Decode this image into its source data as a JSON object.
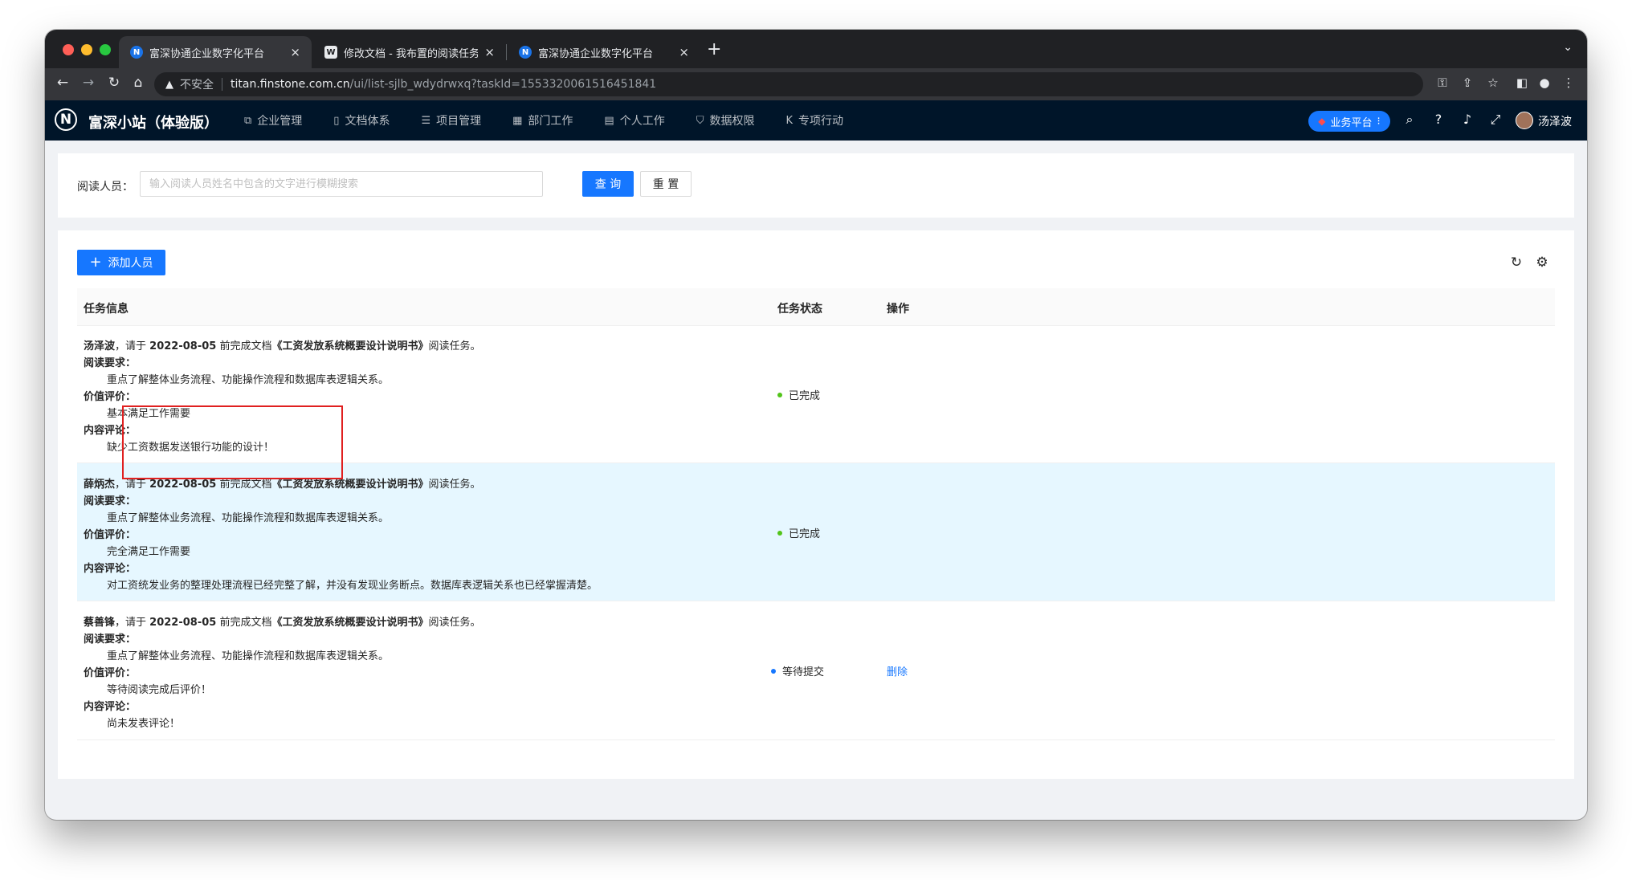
{
  "browser": {
    "tabs": [
      {
        "title": "富深协通企业数字化平台",
        "icon": "app-logo",
        "active": true
      },
      {
        "title": "修改文档 - 我布置的阅读任务 - 富",
        "icon": "doc-icon",
        "active": false
      },
      {
        "title": "富深协通企业数字化平台",
        "icon": "app-logo",
        "active": false
      }
    ],
    "close_glyph": "×",
    "new_tab_glyph": "+",
    "security_label": "不安全",
    "url_host": "titan.finstone.com.cn",
    "url_path": "/ui/list-sjlb_wdydrwxq?taskId=1553320061516451841"
  },
  "app": {
    "logo_letter": "N",
    "name": "富深小站（体验版）",
    "menu": [
      {
        "label": "企业管理",
        "icon": "enterprise-icon"
      },
      {
        "label": "文档体系",
        "icon": "document-icon"
      },
      {
        "label": "项目管理",
        "icon": "list-icon"
      },
      {
        "label": "部门工作",
        "icon": "grid-icon"
      },
      {
        "label": "个人工作",
        "icon": "profile-icon"
      },
      {
        "label": "数据权限",
        "icon": "shield-icon"
      },
      {
        "label": "专项行动",
        "icon": "k-icon"
      }
    ],
    "platform_button": "业务平台",
    "user_name": "汤泽波"
  },
  "search": {
    "label": "阅读人员：",
    "placeholder": "输入阅读人员姓名中包含的文字进行模糊搜索",
    "query_button": "查 询",
    "reset_button": "重 置"
  },
  "table": {
    "add_button": "添加人员",
    "columns": {
      "info": "任务信息",
      "status": "任务状态",
      "action": "操作"
    },
    "labels": {
      "requirement": "阅读要求：",
      "value_eval": "价值评价：",
      "content_comment": "内容评论："
    },
    "rows": [
      {
        "name": "汤泽波",
        "pre": "，请于 ",
        "date": "2022-08-05",
        "mid": " 前完成文档",
        "doc": "《工资发放系统概要设计说明书》",
        "post": "阅读任务。",
        "requirement": "重点了解整体业务流程、功能操作流程和数据库表逻辑关系。",
        "value_eval": "基本满足工作需要",
        "content_comment": "缺少工资数据发送银行功能的设计！",
        "status": "已完成",
        "status_color": "#52c41a",
        "action": ""
      },
      {
        "name": "薛炳杰",
        "pre": "，请于 ",
        "date": "2022-08-05",
        "mid": " 前完成文档",
        "doc": "《工资发放系统概要设计说明书》",
        "post": "阅读任务。",
        "requirement": "重点了解整体业务流程、功能操作流程和数据库表逻辑关系。",
        "value_eval": "完全满足工作需要",
        "content_comment": "对工资统发业务的整理处理流程已经完整了解，并没有发现业务断点。数据库表逻辑关系也已经掌握清楚。",
        "status": "已完成",
        "status_color": "#52c41a",
        "action": ""
      },
      {
        "name": "蔡善锋",
        "pre": "，请于 ",
        "date": "2022-08-05",
        "mid": " 前完成文档",
        "doc": "《工资发放系统概要设计说明书》",
        "post": "阅读任务。",
        "requirement": "重点了解整体业务流程、功能操作流程和数据库表逻辑关系。",
        "value_eval": "等待阅读完成后评价！",
        "content_comment": "尚未发表评论！",
        "status": "等待提交",
        "status_color": "#1677ff",
        "action": "删除"
      }
    ]
  }
}
